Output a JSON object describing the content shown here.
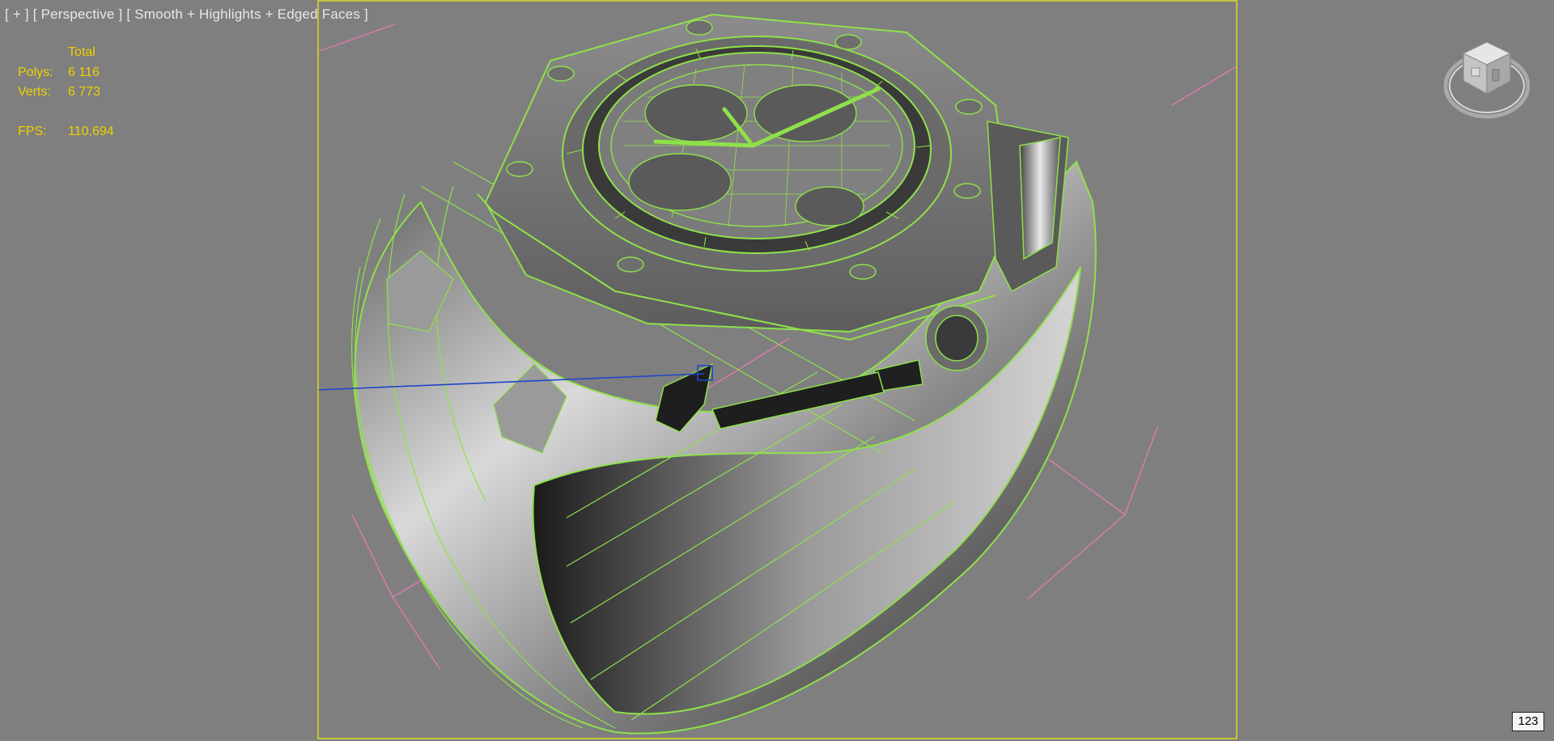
{
  "viewport": {
    "label_plus": "[ + ]",
    "label_view": "[ Perspective ]",
    "label_shading": "[ Smooth + Highlights + Edged Faces ]"
  },
  "stats": {
    "header": "Total",
    "polys_label": "Polys:",
    "polys_value": "6 116",
    "verts_label": "Verts:",
    "verts_value": "6 773",
    "fps_label": "FPS:",
    "fps_value": "110,694"
  },
  "corner_counter": "123",
  "colors": {
    "background": "#7f7f7f",
    "wire": "#8fe14a",
    "stats_text": "#f0d000",
    "safe_frame": "#c6c23a",
    "bounding_box": "#e07ab0",
    "axis": "#1e46c8"
  },
  "icons": {
    "viewcube": "viewcube-icon"
  }
}
